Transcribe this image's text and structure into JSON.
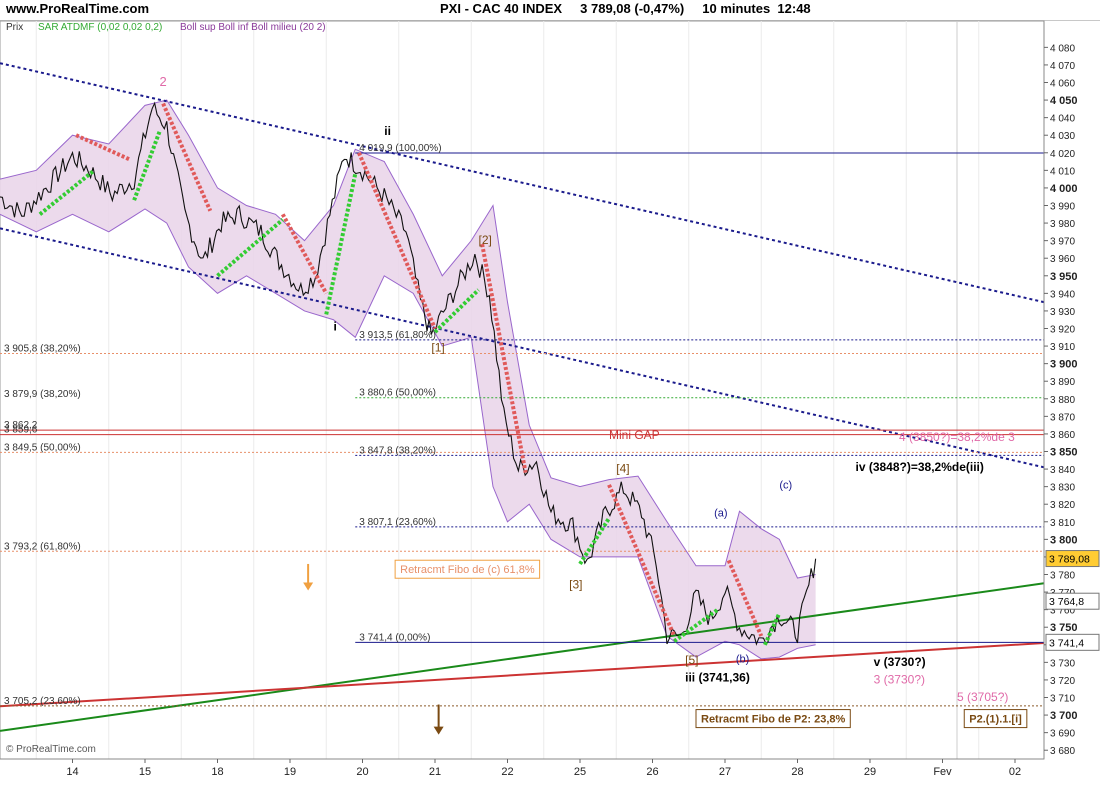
{
  "header": {
    "site": "www.ProRealTime.com",
    "title": "PXI - CAC 40 INDEX     3 789,08 (-0,47%)     10 minutes  12:48"
  },
  "legend": {
    "prix": "Prix",
    "sar": "SAR ATDMF (0,02 0,02 0,2)",
    "boll": "Boll sup Boll inf Boll milieu (20 2)"
  },
  "footer_logo": "© ProRealTime.com",
  "colors": {
    "price": "#101010",
    "boll_band": "#9966cc",
    "boll_fill": "#ead6ea",
    "sar_down": "#e05a5a",
    "sar_up": "#33cc33",
    "channel": "#1a1a8c",
    "trend_green": "#1a8a1a",
    "trend_red": "#cc3333",
    "pink": "#e06aa8",
    "orange": "#f0a040",
    "brown": "#7a4a12"
  },
  "chart_data": {
    "type": "line",
    "title": "PXI - CAC 40 INDEX",
    "timeframe": "10 minutes",
    "last_price": 3789.08,
    "change_percent": -0.47,
    "ylim": [
      3680,
      4090
    ],
    "y_ticks": [
      "4 080",
      "4 070",
      "4 060",
      "4 050",
      "4 040",
      "4 030",
      "4 020",
      "4 010",
      "4 000",
      "3 990",
      "3 980",
      "3 970",
      "3 960",
      "3 950",
      "3 940",
      "3 930",
      "3 920",
      "3 910",
      "3 900",
      "3 890",
      "3 880",
      "3 870",
      "3 860",
      "3 850",
      "3 840",
      "3 830",
      "3 820",
      "3 810",
      "3 800",
      "3 790",
      "3 780",
      "3 770",
      "3 760",
      "3 750",
      "3 740",
      "3 730",
      "3 720",
      "3 710",
      "3 700",
      "3 690",
      "3 680"
    ],
    "y_tick_values": [
      4080,
      4070,
      4060,
      4050,
      4040,
      4030,
      4020,
      4010,
      4000,
      3990,
      3980,
      3970,
      3960,
      3950,
      3940,
      3930,
      3920,
      3910,
      3900,
      3890,
      3880,
      3870,
      3860,
      3850,
      3840,
      3830,
      3820,
      3810,
      3800,
      3790,
      3780,
      3770,
      3760,
      3750,
      3740,
      3730,
      3720,
      3710,
      3700,
      3690,
      3680
    ],
    "y_tick_bold": [
      "4 050",
      "4 000",
      "3 950",
      "3 900",
      "3 850",
      "3 800",
      "3 750",
      "3 700"
    ],
    "x_labels": [
      "14",
      "15",
      "18",
      "19",
      "20",
      "21",
      "22",
      "25",
      "26",
      "27",
      "28",
      "29",
      "Fev",
      "02"
    ],
    "x_start": 0,
    "x_end": 14.4,
    "price_anchors": [
      [
        0,
        3995
      ],
      [
        0.3,
        3985
      ],
      [
        0.7,
        4003
      ],
      [
        1.0,
        4018
      ],
      [
        1.25,
        4010
      ],
      [
        1.55,
        3996
      ],
      [
        1.85,
        4005
      ],
      [
        2.1,
        4046
      ],
      [
        2.3,
        4035
      ],
      [
        2.55,
        3985
      ],
      [
        2.8,
        3958
      ],
      [
        3.05,
        3980
      ],
      [
        3.3,
        3985
      ],
      [
        3.6,
        3975
      ],
      [
        3.85,
        3958
      ],
      [
        4.15,
        3942
      ],
      [
        4.35,
        3950
      ],
      [
        4.55,
        3985
      ],
      [
        4.75,
        4019
      ],
      [
        5.0,
        4010
      ],
      [
        5.3,
        3995
      ],
      [
        5.6,
        3975
      ],
      [
        5.8,
        3935
      ],
      [
        5.95,
        3916
      ],
      [
        6.25,
        3940
      ],
      [
        6.55,
        3962
      ],
      [
        6.75,
        3940
      ],
      [
        6.95,
        3870
      ],
      [
        7.15,
        3840
      ],
      [
        7.4,
        3844
      ],
      [
        7.6,
        3815
      ],
      [
        7.9,
        3808
      ],
      [
        8.1,
        3786
      ],
      [
        8.35,
        3815
      ],
      [
        8.6,
        3829
      ],
      [
        8.85,
        3815
      ],
      [
        9.05,
        3787
      ],
      [
        9.2,
        3745
      ],
      [
        9.4,
        3745
      ],
      [
        9.6,
        3768
      ],
      [
        9.8,
        3754
      ],
      [
        10.0,
        3771
      ],
      [
        10.2,
        3750
      ],
      [
        10.5,
        3742
      ],
      [
        10.75,
        3757
      ],
      [
        11.0,
        3747
      ],
      [
        11.25,
        3789
      ]
    ],
    "boll_upper": [
      [
        0,
        4005
      ],
      [
        0.5,
        4010
      ],
      [
        1.0,
        4030
      ],
      [
        1.5,
        4025
      ],
      [
        2.0,
        4047
      ],
      [
        2.3,
        4050
      ],
      [
        2.6,
        4030
      ],
      [
        3.0,
        4000
      ],
      [
        3.4,
        3990
      ],
      [
        3.8,
        3985
      ],
      [
        4.2,
        3970
      ],
      [
        4.6,
        3990
      ],
      [
        4.9,
        4022
      ],
      [
        5.3,
        4015
      ],
      [
        5.7,
        3985
      ],
      [
        6.1,
        3950
      ],
      [
        6.5,
        3970
      ],
      [
        6.8,
        3990
      ],
      [
        7.0,
        3935
      ],
      [
        7.3,
        3865
      ],
      [
        7.6,
        3835
      ],
      [
        8.0,
        3830
      ],
      [
        8.4,
        3834
      ],
      [
        8.8,
        3836
      ],
      [
        9.2,
        3810
      ],
      [
        9.6,
        3785
      ],
      [
        10.0,
        3785
      ],
      [
        10.2,
        3816
      ],
      [
        10.5,
        3806
      ],
      [
        10.75,
        3800
      ],
      [
        11.0,
        3778
      ],
      [
        11.25,
        3780
      ]
    ],
    "boll_lower": [
      [
        0,
        3985
      ],
      [
        0.5,
        3975
      ],
      [
        1.0,
        3985
      ],
      [
        1.5,
        3975
      ],
      [
        2.0,
        3988
      ],
      [
        2.3,
        3980
      ],
      [
        2.6,
        3955
      ],
      [
        3.0,
        3940
      ],
      [
        3.4,
        3950
      ],
      [
        3.8,
        3940
      ],
      [
        4.2,
        3930
      ],
      [
        4.6,
        3925
      ],
      [
        4.9,
        3915
      ],
      [
        5.3,
        3950
      ],
      [
        5.7,
        3940
      ],
      [
        6.1,
        3910
      ],
      [
        6.5,
        3915
      ],
      [
        6.8,
        3830
      ],
      [
        7.0,
        3810
      ],
      [
        7.3,
        3820
      ],
      [
        7.6,
        3800
      ],
      [
        8.0,
        3790
      ],
      [
        8.4,
        3790
      ],
      [
        8.8,
        3790
      ],
      [
        9.2,
        3745
      ],
      [
        9.6,
        3733
      ],
      [
        10.0,
        3742
      ],
      [
        10.2,
        3740
      ],
      [
        10.5,
        3732
      ],
      [
        10.75,
        3733
      ],
      [
        11.0,
        3738
      ],
      [
        11.25,
        3740
      ]
    ],
    "sar_segments": [
      {
        "dir": "up",
        "points": [
          [
            0.55,
            3985
          ],
          [
            1.3,
            4010
          ]
        ]
      },
      {
        "dir": "down",
        "points": [
          [
            1.05,
            4030
          ],
          [
            1.8,
            4016
          ]
        ]
      },
      {
        "dir": "up",
        "points": [
          [
            1.85,
            3993
          ],
          [
            2.2,
            4032
          ]
        ]
      },
      {
        "dir": "down",
        "points": [
          [
            2.25,
            4048
          ],
          [
            2.9,
            3987
          ]
        ]
      },
      {
        "dir": "up",
        "points": [
          [
            3.0,
            3950
          ],
          [
            3.9,
            3982
          ]
        ]
      },
      {
        "dir": "down",
        "points": [
          [
            3.9,
            3985
          ],
          [
            4.5,
            3940
          ]
        ]
      },
      {
        "dir": "up",
        "points": [
          [
            4.5,
            3928
          ],
          [
            4.9,
            4008
          ]
        ]
      },
      {
        "dir": "down",
        "points": [
          [
            4.95,
            4020
          ],
          [
            6.0,
            3920
          ]
        ]
      },
      {
        "dir": "up",
        "points": [
          [
            6.0,
            3918
          ],
          [
            6.6,
            3942
          ]
        ]
      },
      {
        "dir": "down",
        "points": [
          [
            6.65,
            3968
          ],
          [
            7.25,
            3838
          ]
        ]
      },
      {
        "dir": "up",
        "points": [
          [
            8.0,
            3786
          ],
          [
            8.4,
            3812
          ]
        ]
      },
      {
        "dir": "down",
        "points": [
          [
            8.4,
            3831
          ],
          [
            9.3,
            3745
          ]
        ]
      },
      {
        "dir": "up",
        "points": [
          [
            9.3,
            3742
          ],
          [
            9.9,
            3760
          ]
        ]
      },
      {
        "dir": "down",
        "points": [
          [
            10.05,
            3788
          ],
          [
            10.5,
            3745
          ]
        ]
      },
      {
        "dir": "up",
        "points": [
          [
            10.55,
            3740
          ],
          [
            10.75,
            3758
          ]
        ]
      }
    ],
    "channel_lines": [
      {
        "from": [
          0,
          4071
        ],
        "to": [
          14.4,
          3935
        ]
      },
      {
        "from": [
          0,
          3977
        ],
        "to": [
          14.4,
          3841
        ]
      }
    ],
    "trend_lines": [
      {
        "color": "green",
        "from": [
          0,
          3691
        ],
        "to": [
          14.4,
          3775
        ]
      },
      {
        "color": "red",
        "from": [
          0,
          3705
        ],
        "to": [
          14.4,
          3741
        ]
      }
    ],
    "fibo_levels": [
      {
        "label": "4 019,9 (100,00%)",
        "value": 4019.9,
        "x_start": 4.9,
        "style": "solid",
        "color": "#1a1a8c"
      },
      {
        "label": "3 913,5 (61,80%)",
        "value": 3913.5,
        "x_start": 4.9,
        "style": "dotted",
        "color": "#1a1a8c"
      },
      {
        "label": "3 905,8 (38,20%)",
        "value": 3905.8,
        "x_start": 0,
        "style": "dotted",
        "color": "#e8906a"
      },
      {
        "label": "3 880,6 (50,00%)",
        "value": 3880.6,
        "x_start": 4.9,
        "style": "dotted",
        "color": "#33aa33"
      },
      {
        "label": "3 879,9 (38,20%)",
        "value": 3879.9,
        "x_start": 0,
        "style": "none",
        "color": "#33aa33"
      },
      {
        "label": "3 862,2",
        "value": 3862.2,
        "x_start": 0,
        "style": "solid",
        "color": "#cc3333"
      },
      {
        "label": "3 859,6",
        "value": 3859.6,
        "x_start": 0,
        "style": "solid",
        "color": "#cc3333"
      },
      {
        "label": "3 849,5 (50,00%)",
        "value": 3849.5,
        "x_start": 0,
        "style": "dotted",
        "color": "#e8906a"
      },
      {
        "label": "3 847,8 (38,20%)",
        "value": 3847.8,
        "x_start": 4.9,
        "style": "dotted",
        "color": "#1a1a8c"
      },
      {
        "label": "3 807,1 (23,60%)",
        "value": 3807.1,
        "x_start": 4.9,
        "style": "dotted",
        "color": "#1a1a8c"
      },
      {
        "label": "3 793,2 (61,80%)",
        "value": 3793.2,
        "x_start": 0,
        "style": "dotted",
        "color": "#e8906a"
      },
      {
        "label": "3 741,4 (0,00%)",
        "value": 3741.4,
        "x_start": 4.9,
        "style": "solid",
        "color": "#1a1a8c"
      },
      {
        "label": "3 705,2 (23,60%)",
        "value": 3705.2,
        "x_start": 0,
        "style": "dotted",
        "color": "#8a5a2a"
      }
    ],
    "price_tags": [
      {
        "label": "3 789,08",
        "value": 3789.08,
        "bg": "#ffcc33"
      },
      {
        "label": "3 764,8",
        "value": 3764.8,
        "bg": "#ffffff"
      },
      {
        "label": "3 741,4",
        "value": 3741.4,
        "bg": "#ffffff"
      }
    ],
    "annotations": [
      {
        "text": "2",
        "x": 2.2,
        "y": 4058,
        "color": "#e06aa8",
        "size": 13,
        "weight": "normal"
      },
      {
        "text": "ii",
        "x": 5.3,
        "y": 4030,
        "color": "#000000",
        "size": 12,
        "weight": "bold"
      },
      {
        "text": "i",
        "x": 4.6,
        "y": 3919,
        "color": "#000000",
        "size": 12,
        "weight": "bold"
      },
      {
        "text": "[2]",
        "x": 6.6,
        "y": 3968,
        "color": "#7a4a12",
        "size": 12,
        "weight": "normal"
      },
      {
        "text": "[1]",
        "x": 5.95,
        "y": 3907,
        "color": "#7a4a12",
        "size": 12,
        "weight": "normal"
      },
      {
        "text": "Mini GAP",
        "x": 8.4,
        "y": 3857,
        "color": "#cc3333",
        "size": 12,
        "weight": "normal"
      },
      {
        "text": "[4]",
        "x": 8.5,
        "y": 3838,
        "color": "#7a4a12",
        "size": 12,
        "weight": "normal"
      },
      {
        "text": "[3]",
        "x": 7.85,
        "y": 3772,
        "color": "#7a4a12",
        "size": 12,
        "weight": "normal"
      },
      {
        "text": "(a)",
        "x": 9.85,
        "y": 3813,
        "color": "#1a1a8c",
        "size": 11,
        "weight": "normal"
      },
      {
        "text": "(b)",
        "x": 10.15,
        "y": 3730,
        "color": "#1a1a8c",
        "size": 11,
        "weight": "normal"
      },
      {
        "text": "(c)",
        "x": 10.75,
        "y": 3829,
        "color": "#1a1a8c",
        "size": 11,
        "weight": "normal"
      },
      {
        "text": "iv (3848?)=38,2%de(iii)",
        "x": 11.8,
        "y": 3839,
        "color": "#000000",
        "size": 12,
        "weight": "bold"
      },
      {
        "text": "4 (3850?)=38,2%de 3",
        "x": 12.4,
        "y": 3856,
        "color": "#e06aa8",
        "size": 12,
        "weight": "normal"
      },
      {
        "text": "[5]",
        "x": 9.45,
        "y": 3729,
        "color": "#7a4a12",
        "size": 12,
        "weight": "normal"
      },
      {
        "text": "iii (3741,36)",
        "x": 9.45,
        "y": 3719,
        "color": "#000000",
        "size": 12,
        "weight": "bold"
      },
      {
        "text": "v (3730?)",
        "x": 12.05,
        "y": 3728,
        "color": "#000000",
        "size": 12,
        "weight": "bold"
      },
      {
        "text": "3 (3730?)",
        "x": 12.05,
        "y": 3718,
        "color": "#e06aa8",
        "size": 12,
        "weight": "normal"
      },
      {
        "text": "5 (3705?)",
        "x": 13.2,
        "y": 3708,
        "color": "#e06aa8",
        "size": 12,
        "weight": "normal"
      }
    ],
    "boxes": [
      {
        "text": "Retracmt Fibo de (c) 61,8%",
        "x": 5.45,
        "y": 3783,
        "color": "#f0a040",
        "text_color": "#e8906a"
      },
      {
        "text": "Retracmt Fibo de P2: 23,8%",
        "x": 9.6,
        "y": 3698,
        "color": "#7a4a12",
        "text_color": "#7a4a12"
      },
      {
        "text": "P2.(1).1.[i]",
        "x": 13.3,
        "y": 3698,
        "color": "#7a4a12",
        "text_color": "#7a4a12"
      }
    ],
    "arrows": [
      {
        "x": 4.25,
        "from": 3786,
        "to": 3772,
        "color": "#f0a040"
      },
      {
        "x": 6.05,
        "from": 3706,
        "to": 3690,
        "color": "#7a4a12"
      }
    ],
    "vertical_marker_x": 13.2
  }
}
